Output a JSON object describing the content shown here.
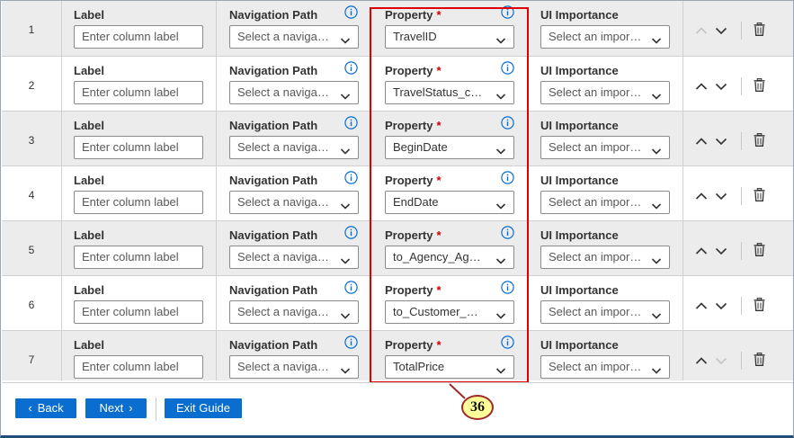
{
  "columns": {
    "label": "Label",
    "navigation_path": "Navigation Path",
    "property": "Property",
    "required_marker": "*",
    "ui_importance": "UI Importance"
  },
  "placeholders": {
    "label": "Enter column label",
    "navigation_path": "Select a navigati...",
    "ui_importance": "Select an import..."
  },
  "rows": [
    {
      "index": "1",
      "property": "TravelID",
      "move_up_enabled": false,
      "move_down_enabled": true
    },
    {
      "index": "2",
      "property": "TravelStatus_code",
      "move_up_enabled": true,
      "move_down_enabled": true
    },
    {
      "index": "3",
      "property": "BeginDate",
      "move_up_enabled": true,
      "move_down_enabled": true
    },
    {
      "index": "4",
      "property": "EndDate",
      "move_up_enabled": true,
      "move_down_enabled": true
    },
    {
      "index": "5",
      "property": "to_Agency_Agen...",
      "move_up_enabled": true,
      "move_down_enabled": true
    },
    {
      "index": "6",
      "property": "to_Customer_Cus...",
      "move_up_enabled": true,
      "move_down_enabled": true
    },
    {
      "index": "7",
      "property": "TotalPrice",
      "move_up_enabled": true,
      "move_down_enabled": false
    }
  ],
  "footer": {
    "back_label": "Back",
    "next_label": "Next",
    "exit_label": "Exit Guide"
  },
  "annotation": {
    "callout_number": "36",
    "highlight_color": "#e00000",
    "callout_fill": "#ffff99"
  },
  "icons": {
    "info": "info-circle-icon",
    "chevron": "chevron-down-icon",
    "move_up": "chevron-up-icon",
    "move_down": "chevron-down-icon",
    "delete": "trash-icon",
    "back": "chevron-left-icon",
    "next": "chevron-right-icon"
  },
  "colors": {
    "primary_button": "#0a6ed1",
    "row_alt": "#ececec",
    "info_blue": "#0a6ed1",
    "required_red": "#c00000"
  }
}
